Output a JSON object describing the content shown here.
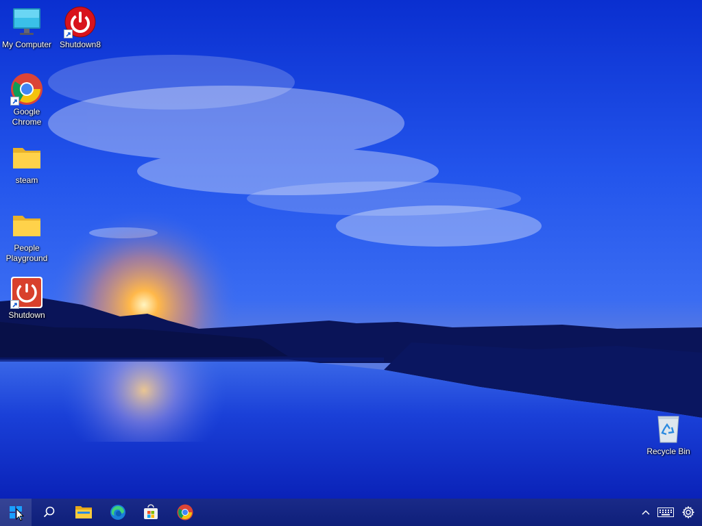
{
  "desktop": {
    "icons": [
      {
        "label": "My Computer"
      },
      {
        "label": "Shutdown8"
      },
      {
        "label": "Google Chrome"
      },
      {
        "label": "steam"
      },
      {
        "label": "People Playground"
      },
      {
        "label": "Shutdown"
      },
      {
        "label": "Recycle Bin"
      }
    ]
  },
  "taskbar": {
    "items": [
      {
        "icon": "windows-start-icon"
      },
      {
        "icon": "search-icon"
      },
      {
        "icon": "file-explorer-icon"
      },
      {
        "icon": "edge-icon"
      },
      {
        "icon": "microsoft-store-icon"
      },
      {
        "icon": "chrome-icon"
      }
    ],
    "tray": [
      {
        "icon": "chevron-up-icon"
      },
      {
        "icon": "keyboard-icon"
      },
      {
        "icon": "gear-icon"
      }
    ]
  },
  "colors": {
    "sky_top": "#0a2fd0",
    "sky_mid": "#2a60f0",
    "sunset": "#ffa040",
    "taskbar": "#0e1f7a"
  }
}
